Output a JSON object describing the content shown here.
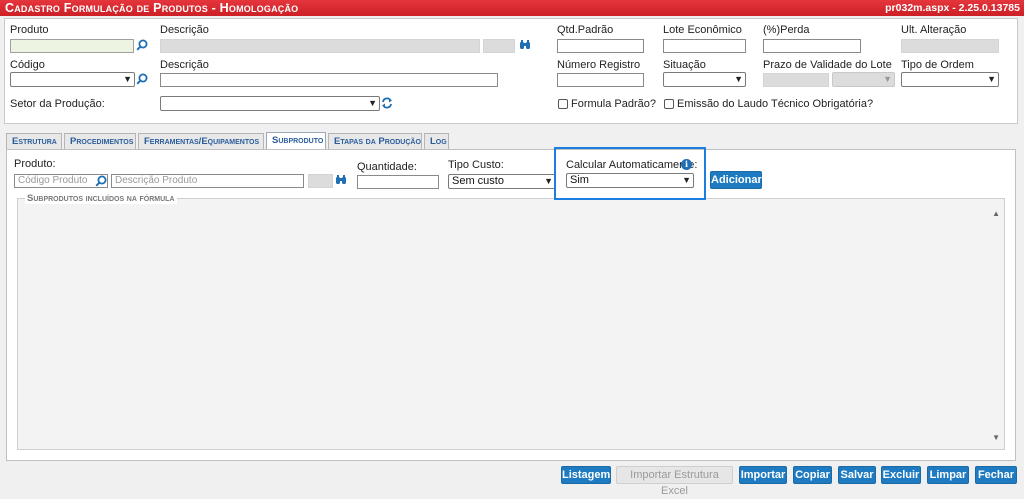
{
  "window": {
    "title": "Cadastro Formulação de Produtos  - Homologação",
    "version": "pr032m.aspx - 2.25.0.13785"
  },
  "header": {
    "produto_label": "Produto",
    "descricao_label": "Descrição",
    "qtd_padrao_label": "Qtd.Padrão",
    "lote_economico_label": "Lote Econômico",
    "perda_label": "(%)Perda",
    "ult_alteracao_label": "Ult. Alteração",
    "codigo_label": "Código",
    "descricao2_label": "Descrição",
    "numero_registro_label": "Número Registro",
    "situacao_label": "Situação",
    "prazo_validade_label": "Prazo de Validade do Lote",
    "tipo_ordem_label": "Tipo de Ordem",
    "setor_producao_label": "Setor da Produção:",
    "formula_padrao_label": "Formula Padrão?",
    "emissao_laudo_label": "Emissão do Laudo Técnico Obrigatória?"
  },
  "tabs": [
    {
      "label": "Estrutura"
    },
    {
      "label": "Procedimentos"
    },
    {
      "label": "Ferramentas/Equipamentos"
    },
    {
      "label": "Subproduto"
    },
    {
      "label": "Etapas da Produção"
    },
    {
      "label": "Log"
    }
  ],
  "subproduto": {
    "produto_label": "Produto:",
    "codigo_placeholder": "Código Produto",
    "descricao_placeholder": "Descrição Produto",
    "quantidade_label": "Quantidade:",
    "tipo_custo_label": "Tipo Custo:",
    "tipo_custo_value": "Sem custo",
    "calcular_label": "Calcular Automaticamente:",
    "calcular_value": "Sim",
    "adicionar_label": "Adicionar",
    "fieldset_legend": "Subprodutos incluídos na fórmula"
  },
  "footer": {
    "listagem": "Listagem",
    "importar_excel": "Importar Estrutura Excel",
    "importar": "Importar",
    "copiar": "Copiar",
    "salvar": "Salvar",
    "excluir": "Excluir",
    "limpar": "Limpar",
    "fechar": "Fechar"
  },
  "colors": {
    "title_bar": "#d9262d",
    "accent_button": "#1f7bc1",
    "highlight_border": "#1b7ee0"
  }
}
